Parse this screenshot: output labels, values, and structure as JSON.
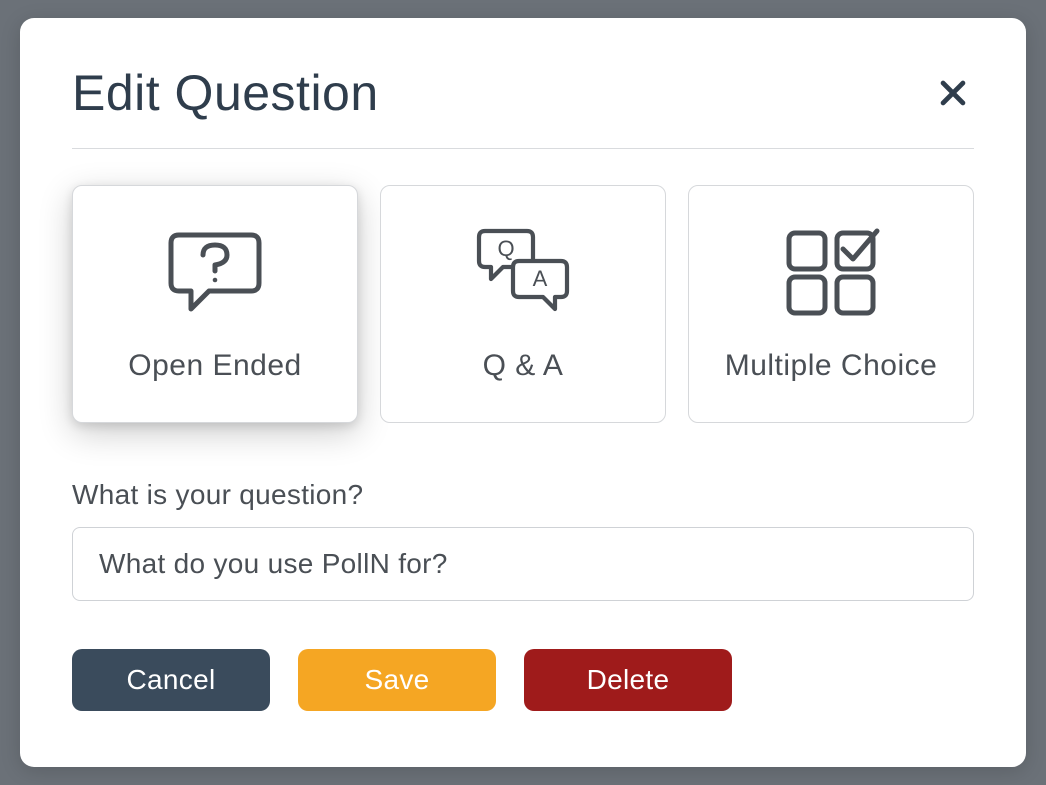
{
  "modal": {
    "title": "Edit Question"
  },
  "types": {
    "open_ended": {
      "label": "Open Ended",
      "selected": true
    },
    "qa": {
      "label": "Q & A",
      "selected": false
    },
    "mc": {
      "label": "Multiple Choice",
      "selected": false
    }
  },
  "question": {
    "label": "What is your question?",
    "value": "What do you use PollN for?"
  },
  "actions": {
    "cancel": "Cancel",
    "save": "Save",
    "delete": "Delete"
  },
  "colors": {
    "title": "#2f3d4c",
    "text": "#4a4f55",
    "border": "#d6d8db",
    "btn_cancel": "#3a4b5c",
    "btn_save": "#f5a623",
    "btn_delete": "#9f1b1b",
    "overlay": "#6b7178"
  }
}
